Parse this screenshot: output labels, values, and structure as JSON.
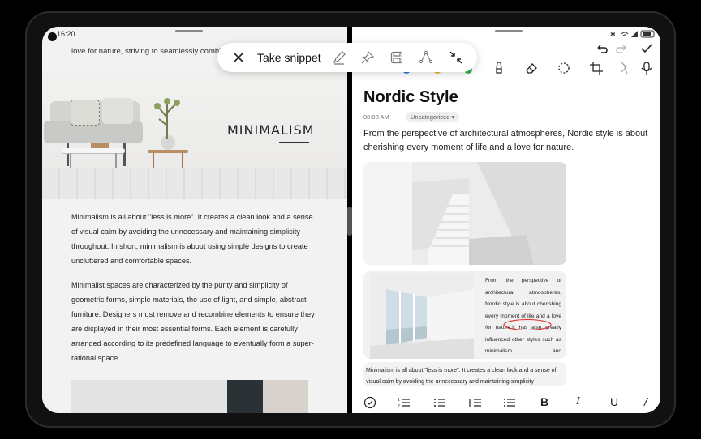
{
  "status": {
    "time": "16:20"
  },
  "left_doc": {
    "top_text": "love for nature, striving to seamlessly combine",
    "hero_title": "MINIMALISM",
    "para1": "Minimalism is all about \"less is more\". It creates a clean look and a sense of visual calm by avoiding the unnecessary and maintaining simplicity throughout. In short, minimalism is about using simple designs to create uncluttered and comfortable spaces.",
    "para2": "Minimalist spaces are characterized by the purity and simplicity of geometric forms, simple materials, the use of light, and simple, abstract furniture. Designers must remove and recombine elements to ensure they are displayed in their most essential forms. Each element is carefully arranged according to its predefined language to eventually form a super-rational space."
  },
  "snippet_bar": {
    "label": "Take snippet"
  },
  "note": {
    "title": "Nordic Style",
    "time": "08:08 AM",
    "category": "Uncategorized",
    "body": "From the perspective of architectural atmospheres, Nordic style is about cherishing every moment of life and a love for nature.",
    "card_text": "From the perspective of architectural atmospheres, Nordic style is about cherishing every moment of life and a love for nature.It has also greatly influenced other styles such as minimalism and postmodernism.",
    "card3_text": "Minimalism is all about \"less is more\". It creates a clean look and a sense of visual calm by avoiding the unnecessary and maintaining simplicity"
  },
  "colors": {
    "pen_blue": "#2f7bd8",
    "pen_yellow": "#e9b23a",
    "pen_green": "#2bb14a",
    "annotation_red": "#d9302c"
  },
  "icons": [
    "close-icon",
    "pen-icon",
    "pin-icon",
    "save-icon",
    "share-icon",
    "crop-icon",
    "undo-icon",
    "redo-icon",
    "check-icon",
    "highlighter-icon",
    "eraser-icon",
    "lasso-icon",
    "frame-icon",
    "mic-icon",
    "checklist-icon",
    "list-icon",
    "bold-icon",
    "italic-icon",
    "underline-icon"
  ]
}
